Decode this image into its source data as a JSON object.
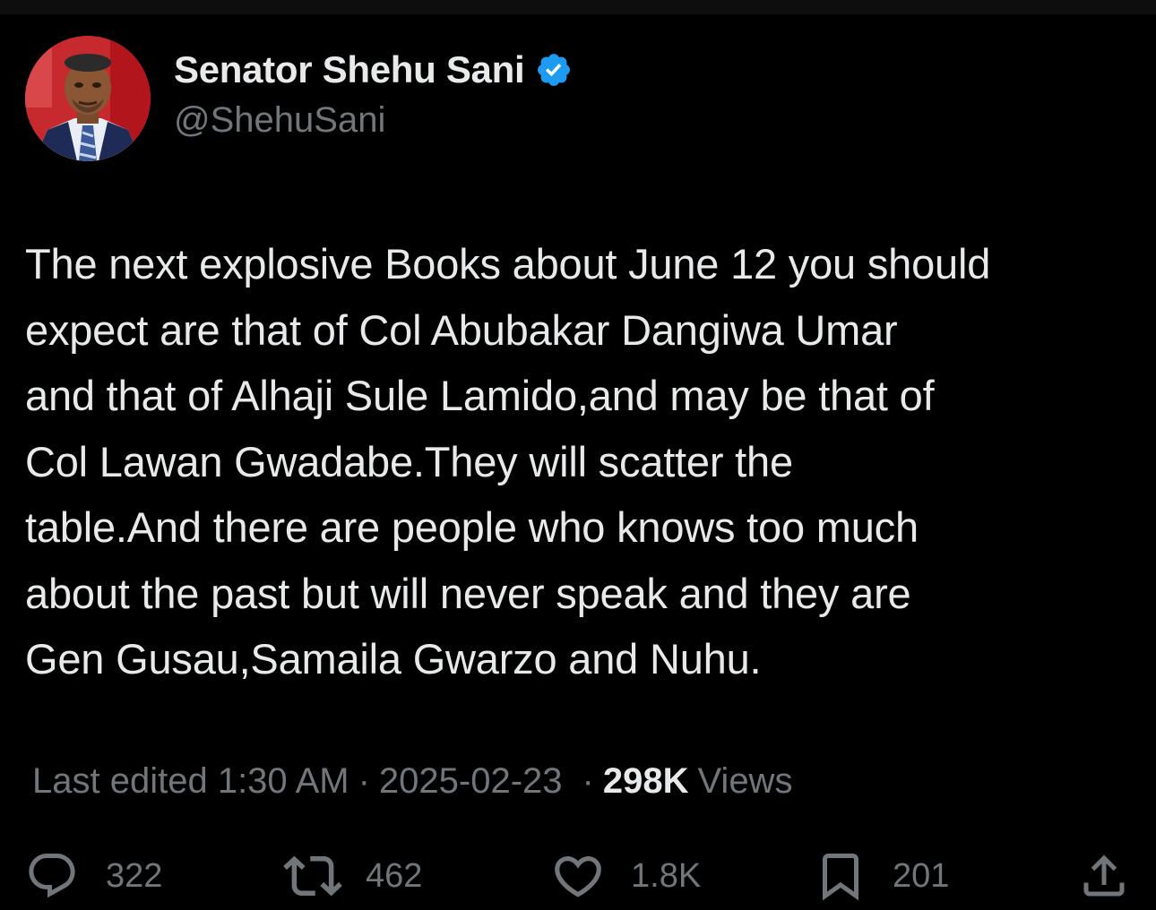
{
  "author": {
    "display_name": "Senator Shehu Sani",
    "handle": "@ShehuSani",
    "verified_icon": "verified-badge-icon",
    "avatar_icon": "avatar-photo"
  },
  "tweet": {
    "lines": [
      "The next explosive Books about June 12 you should",
      "expect are that of Col Abubakar Dangiwa Umar",
      "and that of Alhaji Sule Lamido,and may be that of",
      "Col Lawan Gwadabe.They will scatter the",
      "table.And there are people who knows too much",
      "about the past but will never speak and they are",
      "Gen Gusau,Samaila Gwarzo and Nuhu."
    ]
  },
  "meta": {
    "edited_label": "Last edited 1:30 AM",
    "separator": "·",
    "date": "2025-02-23",
    "views_count": "298K",
    "views_label": "Views"
  },
  "actions": {
    "reply": {
      "icon": "reply-icon",
      "count": "322"
    },
    "repost": {
      "icon": "repost-icon",
      "count": "462"
    },
    "like": {
      "icon": "heart-icon",
      "count": "1.8K"
    },
    "bookmark": {
      "icon": "bookmark-icon",
      "count": "201"
    },
    "share": {
      "icon": "share-icon"
    }
  },
  "colors": {
    "background": "#000000",
    "primary_text": "#e7e9ea",
    "secondary_text": "#71767b",
    "verified_blue": "#1d9bf0"
  }
}
